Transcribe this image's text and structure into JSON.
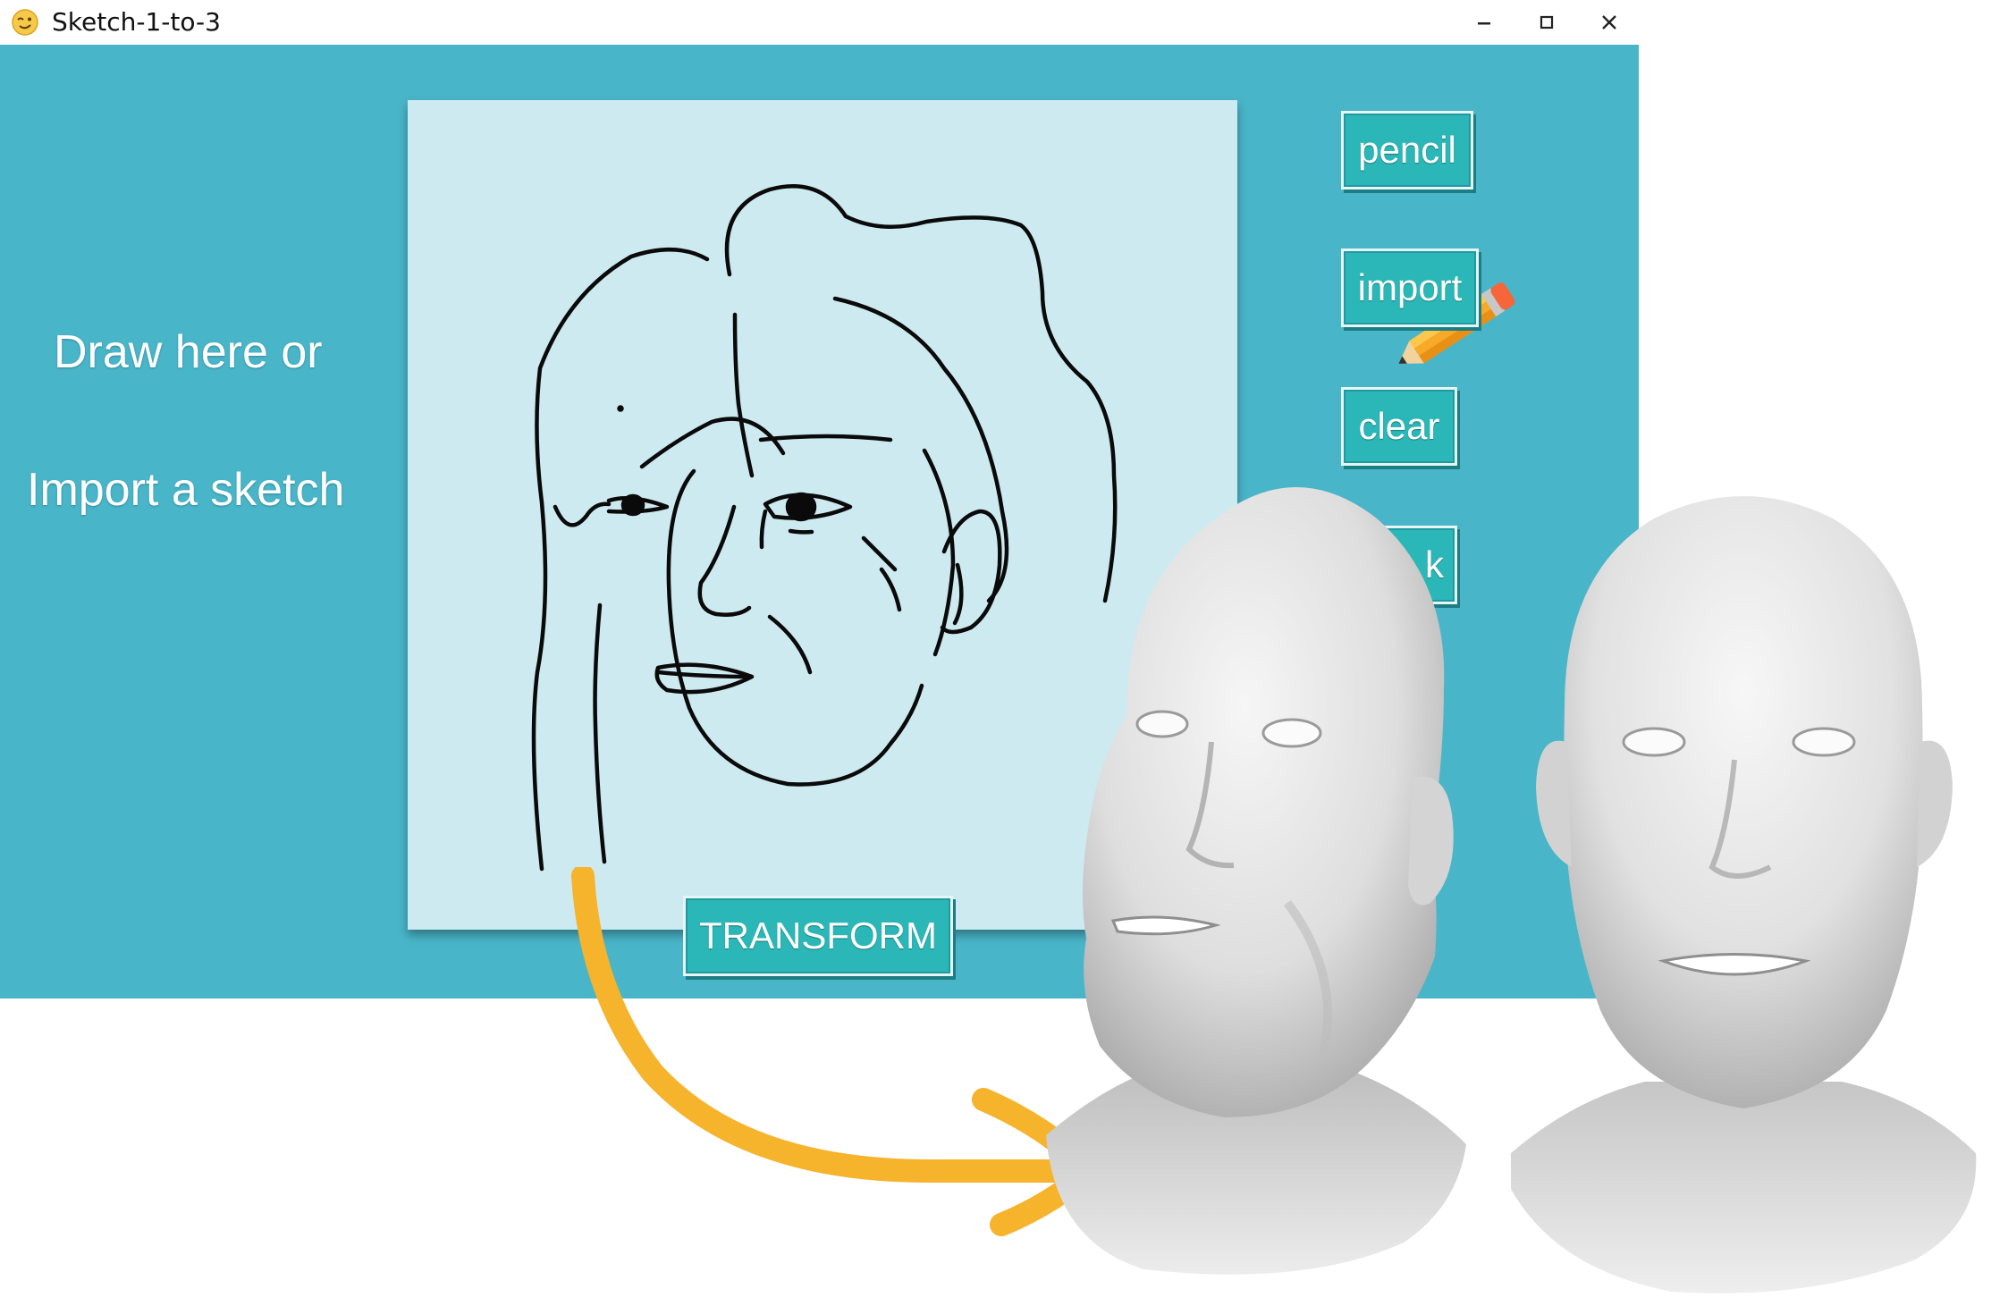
{
  "window": {
    "title": "Sketch-1-to-3",
    "app_icon": "winking-face-icon",
    "controls": [
      "minimize-icon",
      "maximize-icon",
      "close-icon"
    ]
  },
  "prompt": {
    "line1": "Draw here or",
    "line2": "Import a sketch"
  },
  "toolbar": {
    "pencil_label": "pencil",
    "import_label": "import",
    "clear_label": "clear",
    "back_label": "k"
  },
  "actions": {
    "transform_label": "TRANSFORM"
  },
  "colors": {
    "app_background": "#49b5c9",
    "canvas_background": "#cdeaf0",
    "button_face": "#2bb7b7",
    "arrow": "#f6b32c",
    "head_surface": "#e4e4e4"
  },
  "graphics": {
    "sketch": "face-sketch",
    "cursor": "pencil-icon",
    "arrow": "curved-arrow",
    "results": [
      "3d-head-front-left",
      "3d-head-front"
    ]
  }
}
